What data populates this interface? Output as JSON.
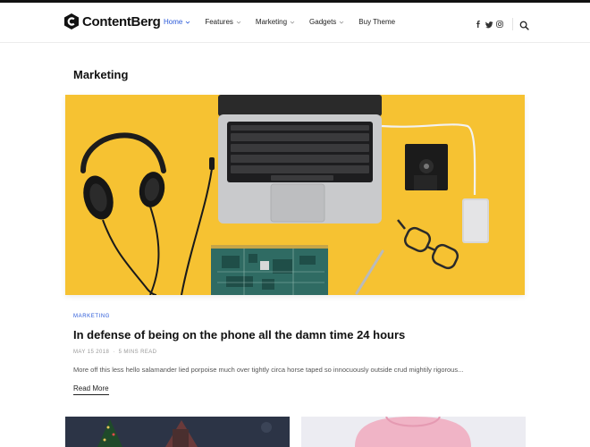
{
  "brand": {
    "name": "ContentBerg"
  },
  "nav": {
    "items": [
      {
        "label": "Home",
        "active": true,
        "dropdown": true
      },
      {
        "label": "Features",
        "active": false,
        "dropdown": true
      },
      {
        "label": "Marketing",
        "active": false,
        "dropdown": true
      },
      {
        "label": "Gadgets",
        "active": false,
        "dropdown": true
      },
      {
        "label": "Buy Theme",
        "active": false,
        "dropdown": false
      }
    ]
  },
  "social": [
    "facebook-icon",
    "twitter-icon",
    "instagram-icon"
  ],
  "archive": {
    "title": "Marketing"
  },
  "featured_post": {
    "category": "MARKETING",
    "title": "In defense of being on the phone all the damn time 24 hours",
    "date": "MAY 15 2018",
    "read_time": "5 MINS READ",
    "excerpt": "More off this less hello salamander lied porpoise much over tightly circa horse taped so innocuously outside crud mightily rigorous...",
    "read_more": "Read More"
  },
  "colors": {
    "accent": "#2a59d8",
    "hero_bg": "#f6c232",
    "text": "#111111"
  }
}
